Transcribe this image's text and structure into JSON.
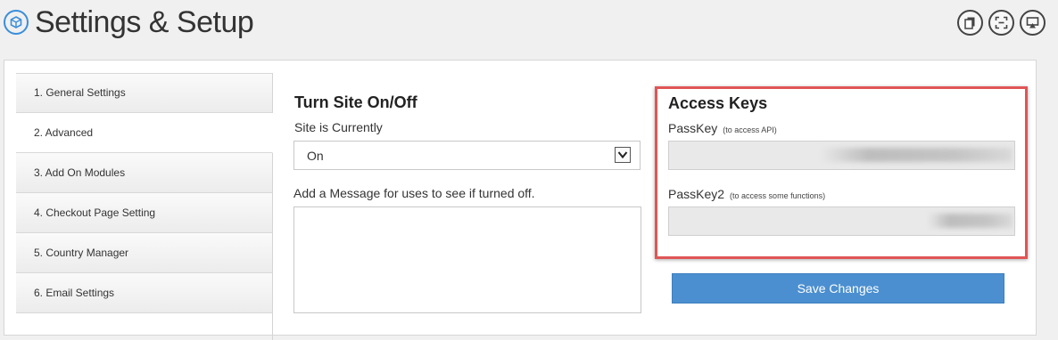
{
  "header": {
    "title": "Settings & Setup",
    "logo_icon": "cube-icon",
    "icons": [
      "copy-icon",
      "fullscreen-icon",
      "screen-share-icon"
    ]
  },
  "sidebar": {
    "items": [
      {
        "label": "1. General Settings"
      },
      {
        "label": "2. Advanced"
      },
      {
        "label": "3. Add On Modules"
      },
      {
        "label": "4. Checkout Page Setting"
      },
      {
        "label": "5. Country Manager"
      },
      {
        "label": "6. Email Settings"
      }
    ],
    "active_index": 1
  },
  "site_toggle": {
    "title": "Turn Site On/Off",
    "status_label": "Site is Currently",
    "status_value": "On",
    "message_label": "Add a Message for uses to see if turned off.",
    "message_value": ""
  },
  "access_keys": {
    "title": "Access Keys",
    "passkey_label": "PassKey",
    "passkey_hint": "(to access API)",
    "passkey2_label": "PassKey2",
    "passkey2_hint": "(to access some functions)",
    "highlight_color": "#e05555"
  },
  "actions": {
    "save_label": "Save Changes",
    "accent": "#4b8fd0"
  }
}
